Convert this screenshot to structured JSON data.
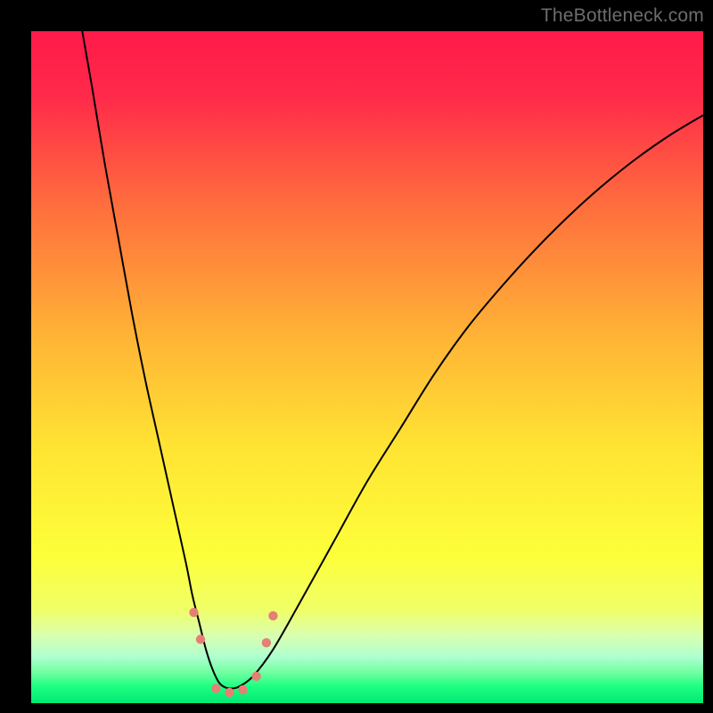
{
  "watermark": "TheBottleneck.com",
  "chart_data": {
    "type": "line",
    "title": "",
    "xlabel": "",
    "ylabel": "",
    "xlim": [
      0,
      100
    ],
    "ylim": [
      0,
      100
    ],
    "gradient_stops": [
      {
        "offset": 0.0,
        "color": "#ff1a4a"
      },
      {
        "offset": 0.1,
        "color": "#ff2b4a"
      },
      {
        "offset": 0.25,
        "color": "#ff6a3e"
      },
      {
        "offset": 0.45,
        "color": "#ffb236"
      },
      {
        "offset": 0.62,
        "color": "#ffe433"
      },
      {
        "offset": 0.78,
        "color": "#fdff3a"
      },
      {
        "offset": 0.86,
        "color": "#f0ff66"
      },
      {
        "offset": 0.9,
        "color": "#d8ffb0"
      },
      {
        "offset": 0.93,
        "color": "#b0ffd0"
      },
      {
        "offset": 0.955,
        "color": "#6effa0"
      },
      {
        "offset": 0.975,
        "color": "#1eff82"
      },
      {
        "offset": 1.0,
        "color": "#00e874"
      }
    ],
    "series": [
      {
        "name": "bottleneck-curve",
        "color": "#000000",
        "width": 2,
        "x": [
          7.6,
          9,
          11,
          13,
          15,
          17,
          19,
          21,
          23,
          24,
          25,
          26,
          27,
          28,
          29,
          30,
          31,
          33,
          36,
          40,
          45,
          50,
          55,
          60,
          65,
          70,
          75,
          80,
          85,
          90,
          95,
          100
        ],
        "y": [
          100,
          92,
          80,
          69,
          58,
          48,
          39,
          30,
          21,
          16,
          12,
          8,
          5,
          3,
          2.3,
          2.2,
          2.5,
          4,
          8,
          15,
          24,
          33,
          41,
          49,
          56,
          62,
          67.5,
          72.5,
          77,
          81,
          84.5,
          87.5
        ]
      }
    ],
    "markers": [
      {
        "x": 24.2,
        "y": 13.5,
        "r": 5.2,
        "color": "#e58074"
      },
      {
        "x": 25.2,
        "y": 9.5,
        "r": 5.2,
        "color": "#e58074"
      },
      {
        "x": 27.5,
        "y": 2.2,
        "r": 5.2,
        "color": "#e58074"
      },
      {
        "x": 29.5,
        "y": 1.6,
        "r": 5.2,
        "color": "#e58074"
      },
      {
        "x": 31.5,
        "y": 2.0,
        "r": 5.2,
        "color": "#e58074"
      },
      {
        "x": 33.5,
        "y": 4.0,
        "r": 5.2,
        "color": "#e58074"
      },
      {
        "x": 35.0,
        "y": 9.0,
        "r": 5.2,
        "color": "#e58074"
      },
      {
        "x": 36.0,
        "y": 13.0,
        "r": 5.2,
        "color": "#e58074"
      }
    ]
  }
}
